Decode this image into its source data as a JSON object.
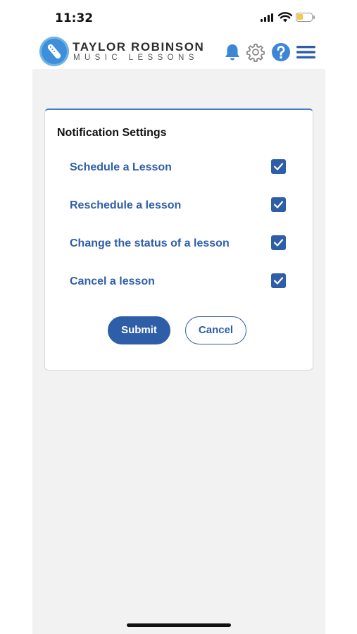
{
  "status_bar": {
    "time": "11:32"
  },
  "header": {
    "brand_title": "TAYLOR ROBINSON",
    "brand_subtitle": "MUSIC LESSONS",
    "icons": [
      "bell-icon",
      "gear-icon",
      "help-icon",
      "menu-icon"
    ]
  },
  "notification_settings": {
    "title": "Notification Settings",
    "options": [
      {
        "label": "Schedule a Lesson",
        "checked": true
      },
      {
        "label": "Reschedule a lesson",
        "checked": true
      },
      {
        "label": "Change the status of a lesson",
        "checked": true
      },
      {
        "label": "Cancel a lesson",
        "checked": true
      }
    ],
    "submit_label": "Submit",
    "cancel_label": "Cancel"
  },
  "colors": {
    "accent": "#2f5ea8",
    "logo": "#3d8fd9",
    "background": "#f2f2f2"
  }
}
